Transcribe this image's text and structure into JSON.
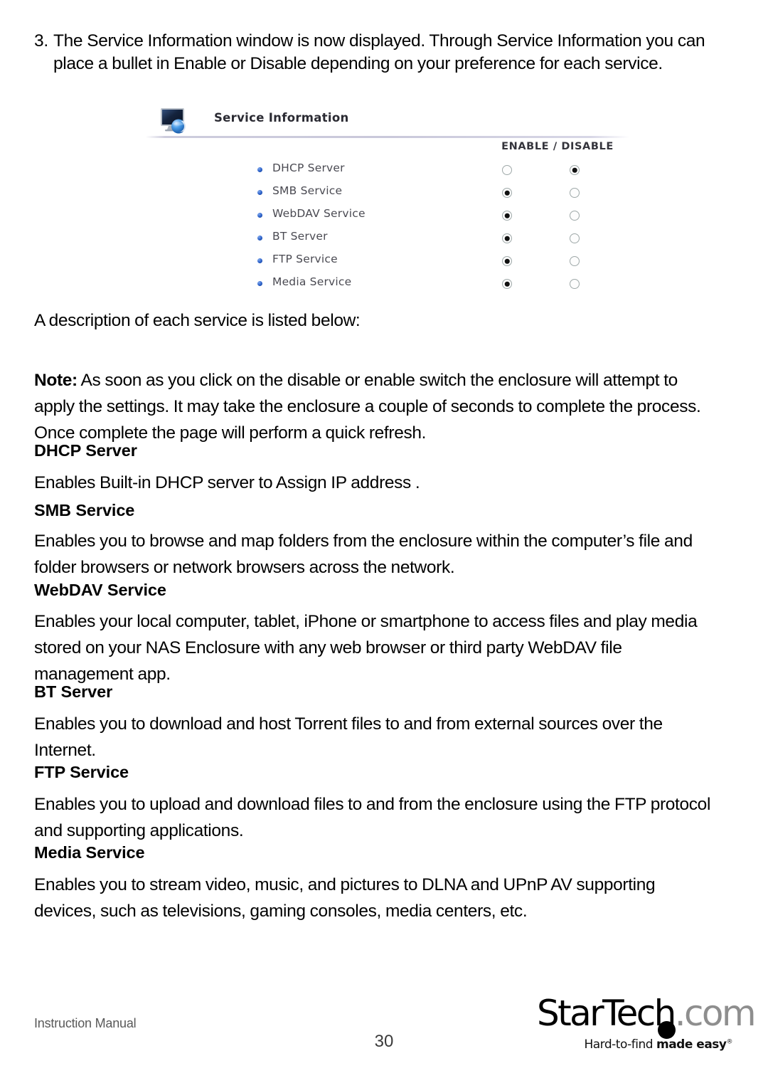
{
  "step": {
    "number": "3.",
    "text": "The Service Information window is now displayed. Through Service Information you can place a bullet in Enable or Disable depending on your preference for each service."
  },
  "figure": {
    "icon_name": "monitor-globe-icon",
    "title": "Service Information",
    "column_header": "ENABLE / DISABLE",
    "columns": [
      "ENABLE",
      "DISABLE"
    ],
    "rows": [
      {
        "label": "DHCP Server",
        "enable_selected": false,
        "disable_selected": true
      },
      {
        "label": "SMB Service",
        "enable_selected": true,
        "disable_selected": false
      },
      {
        "label": "WebDAV Service",
        "enable_selected": true,
        "disable_selected": false
      },
      {
        "label": "BT Server",
        "enable_selected": true,
        "disable_selected": false
      },
      {
        "label": "FTP Service",
        "enable_selected": true,
        "disable_selected": false
      },
      {
        "label": "Media Service",
        "enable_selected": true,
        "disable_selected": false
      }
    ],
    "bullet_color": "#2b60c8",
    "label_color": "#4a4a52",
    "rule_color": "#c9c8da"
  },
  "body": {
    "lead": "A description of each service is listed below:",
    "note_label": "Note:",
    "note_text": " As soon as you click on the disable or enable switch the enclosure will attempt to apply the settings. It may take the enclosure a couple of seconds to complete the process. Once complete the page will perform a quick refresh."
  },
  "sections": {
    "dhcp": {
      "heading": "DHCP Server",
      "text": "Enables Built-in DHCP server to Assign IP address ."
    },
    "smb": {
      "heading": "SMB Service",
      "text": "Enables you to browse and map folders from the enclosure within the computer’s file and folder browsers or network browsers across the network."
    },
    "webdav": {
      "heading": "WebDAV Service",
      "text": "Enables your local computer, tablet, iPhone or smartphone to access files and play media stored on your NAS Enclosure with any web browser or third party WebDAV file management app."
    },
    "bt": {
      "heading": "BT Server",
      "text": "Enables you to download and host Torrent files to and from external sources over the Internet."
    },
    "ftp": {
      "heading": "FTP Service",
      "text": "Enables you to upload and download files to and from the enclosure using the FTP protocol and supporting applications."
    },
    "media": {
      "heading": "Media Service",
      "text": "Enables you to stream video, music, and pictures to DLNA and UPnP AV supporting devices, such as televisions, gaming consoles, media centers, etc."
    }
  },
  "footer": {
    "left": "Instruction Manual",
    "page_number": "30",
    "logo": {
      "brand": "StarTech",
      "suffix": ".com",
      "tagline_light": "Hard-to-find ",
      "tagline_bold": "made easy",
      "tagline_mark": "®",
      "brand_color": "#000000",
      "suffix_color": "#8e8e8e"
    }
  }
}
